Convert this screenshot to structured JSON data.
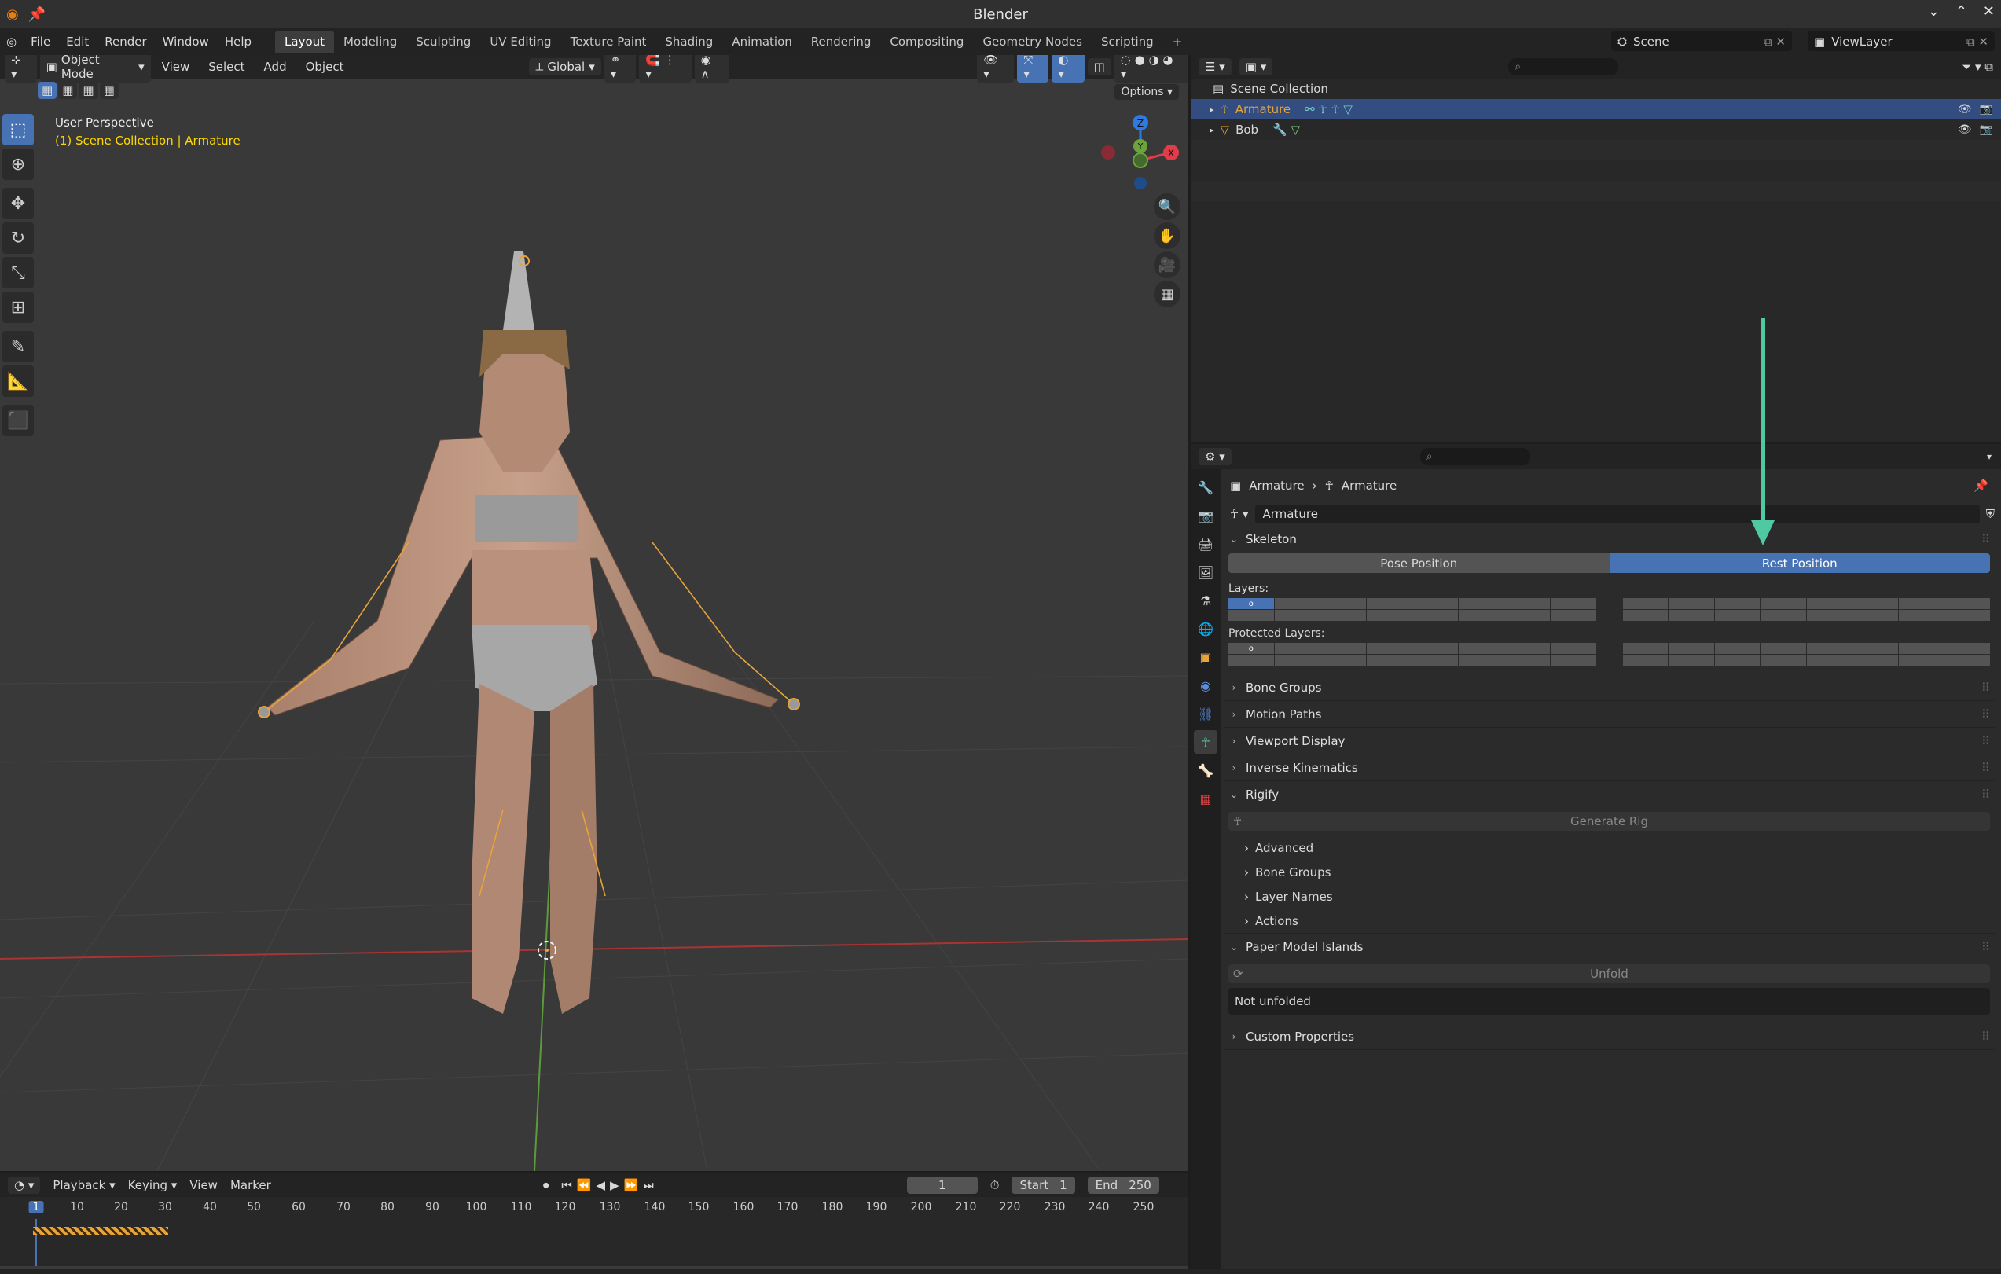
{
  "window": {
    "title": "Blender"
  },
  "menu": {
    "items": [
      "File",
      "Edit",
      "Render",
      "Window",
      "Help"
    ]
  },
  "workspaces": {
    "tabs": [
      "Layout",
      "Modeling",
      "Sculpting",
      "UV Editing",
      "Texture Paint",
      "Shading",
      "Animation",
      "Rendering",
      "Compositing",
      "Geometry Nodes",
      "Scripting"
    ],
    "active": "Layout",
    "add": "+"
  },
  "scene": {
    "name": "Scene",
    "view_layer": "ViewLayer"
  },
  "viewport": {
    "mode": "Object Mode",
    "menus": [
      "View",
      "Select",
      "Add",
      "Object"
    ],
    "transform_orientation": "Global",
    "options_label": "Options",
    "info_line1": "User Perspective",
    "info_line2": "(1) Scene Collection | Armature",
    "gizmo_axes": {
      "x": "X",
      "y": "Y",
      "z": "Z"
    }
  },
  "outliner": {
    "root": "Scene Collection",
    "items": [
      {
        "name": "Armature",
        "selected": true
      },
      {
        "name": "Bob",
        "selected": false
      }
    ]
  },
  "properties": {
    "breadcrumb": [
      "Armature",
      "Armature"
    ],
    "datablock_name": "Armature",
    "skeleton": {
      "title": "Skeleton",
      "pose_position": "Pose Position",
      "rest_position": "Rest Position",
      "active_position": "Rest Position",
      "layers_label": "Layers:",
      "protected_layers_label": "Protected Layers:",
      "layer_marker": "o"
    },
    "collapsed_panels": [
      "Bone Groups",
      "Motion Paths",
      "Viewport Display",
      "Inverse Kinematics"
    ],
    "rigify": {
      "title": "Rigify",
      "generate_button": "Generate Rig",
      "subpanels": [
        "Advanced",
        "Bone Groups",
        "Layer Names",
        "Actions"
      ]
    },
    "paper_model": {
      "title": "Paper Model Islands",
      "unfold_button": "Unfold",
      "status": "Not unfolded"
    },
    "custom_properties": "Custom Properties"
  },
  "timeline": {
    "menus": [
      "Playback",
      "Keying",
      "View",
      "Marker"
    ],
    "current_frame": "1",
    "start_label": "Start",
    "start": "1",
    "end_label": "End",
    "end": "250",
    "ruler": [
      "1",
      "10",
      "20",
      "30",
      "40",
      "50",
      "60",
      "70",
      "80",
      "90",
      "100",
      "110",
      "120",
      "130",
      "140",
      "150",
      "160",
      "170",
      "180",
      "190",
      "200",
      "210",
      "220",
      "230",
      "240",
      "250"
    ]
  },
  "colors": {
    "accent": "#4772b3",
    "annotation_arrow": "#4fc9a2",
    "info_highlight": "#ffd900"
  }
}
